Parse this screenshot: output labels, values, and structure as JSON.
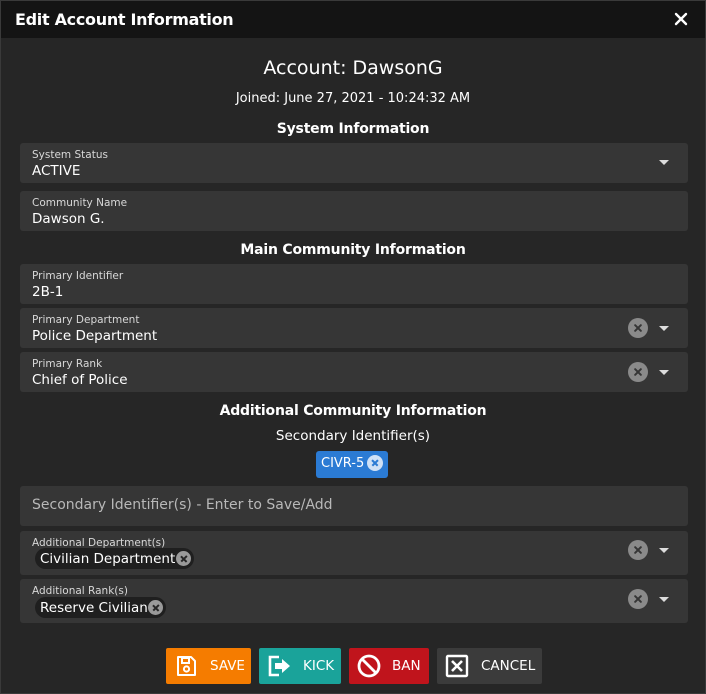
{
  "dialog": {
    "title": "Edit Account Information",
    "account_heading": "Account: DawsonG",
    "joined": "Joined: June 27, 2021 - 10:24:32 AM"
  },
  "sections": {
    "system": "System Information",
    "main": "Main Community Information",
    "additional": "Additional Community Information"
  },
  "fields": {
    "system_status": {
      "label": "System Status",
      "value": "ACTIVE"
    },
    "community_name": {
      "label": "Community Name",
      "value": "Dawson G."
    },
    "primary_identifier": {
      "label": "Primary Identifier",
      "value": "2B-1"
    },
    "primary_department": {
      "label": "Primary Department",
      "value": "Police Department"
    },
    "primary_rank": {
      "label": "Primary Rank",
      "value": "Chief of Police"
    },
    "secondary_identifiers": {
      "label": "Secondary Identifier(s)",
      "chips": [
        "CIVR-5"
      ],
      "placeholder": "Secondary Identifier(s) - Enter to Save/Add"
    },
    "additional_departments": {
      "label": "Additional Department(s)",
      "chips": [
        "Civilian Department"
      ]
    },
    "additional_ranks": {
      "label": "Additional Rank(s)",
      "chips": [
        "Reserve Civilian"
      ]
    }
  },
  "buttons": {
    "save": {
      "label": "SAVE",
      "color": "#f57c00",
      "icon": "save-icon"
    },
    "kick": {
      "label": "KICK",
      "color": "#1aa39a",
      "icon": "exit-icon"
    },
    "ban": {
      "label": "BAN",
      "color": "#c0141c",
      "icon": "ban-icon"
    },
    "cancel": {
      "label": "CANCEL",
      "color": "#3b3b3b",
      "icon": "close-box-icon"
    }
  },
  "colors": {
    "chip_accent": "#2b7bd4",
    "field_bg": "#363636",
    "dialog_bg": "#262626"
  }
}
